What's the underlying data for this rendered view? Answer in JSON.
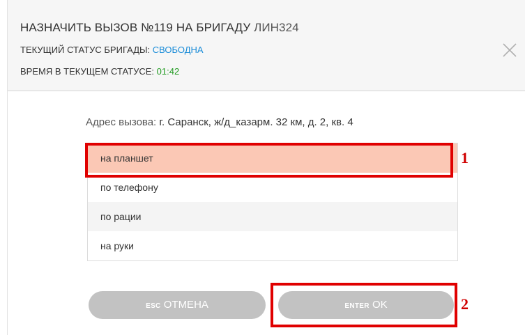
{
  "header": {
    "title_prefix": "НАЗНАЧИТЬ ВЫЗОВ №119 НА БРИГАДУ",
    "brigade_code": "ЛИН324",
    "status_label": "ТЕКУЩИЙ СТАТУС БРИГАДЫ:",
    "status_value": "СВОБОДНА",
    "time_label": "ВРЕМЯ В ТЕКУЩЕМ СТАТУСЕ:",
    "time_value": "01:42"
  },
  "address": {
    "label": "Адрес вызова:",
    "value": "г. Саранск, ж/д_казарм. 32 км, д. 2, кв. 4"
  },
  "options": [
    {
      "label": "на планшет",
      "selected": true
    },
    {
      "label": "по телефону",
      "selected": false
    },
    {
      "label": "по рации",
      "selected": false
    },
    {
      "label": "на руки",
      "selected": false
    }
  ],
  "buttons": {
    "cancel_key": "ESC",
    "cancel_label": "ОТМЕНА",
    "ok_key": "ENTER",
    "ok_label": "OK"
  },
  "annotations": {
    "marker1": "1",
    "marker2": "2"
  },
  "colors": {
    "status_blue": "#1a8cd8",
    "time_green": "#1f9a1f",
    "selected_bg": "#fbc8b5",
    "highlight_red": "#e00000",
    "button_gray": "#c2c2c2"
  }
}
